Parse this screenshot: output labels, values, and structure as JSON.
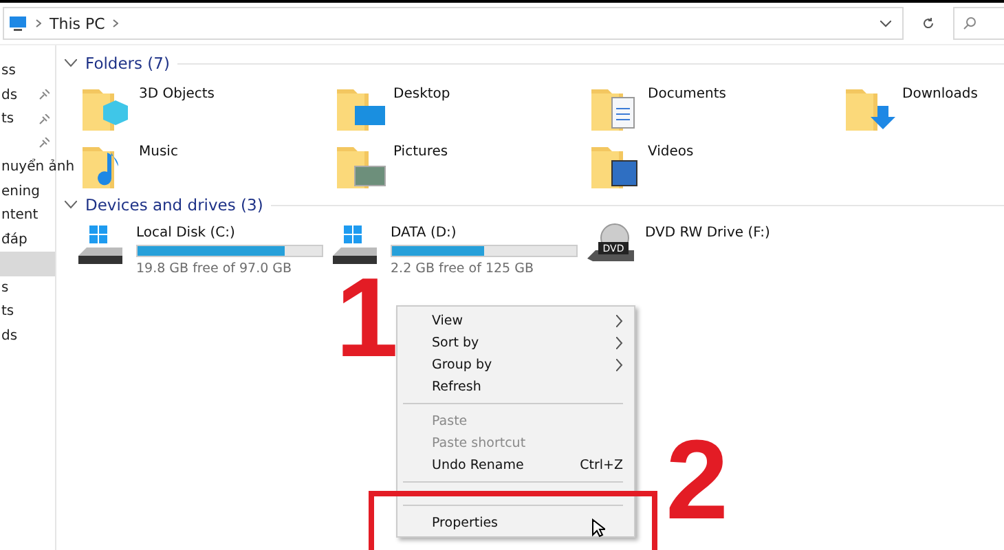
{
  "address_bar": {
    "path": [
      "This PC"
    ]
  },
  "sidebar": {
    "items": [
      {
        "label": "ss",
        "pinned": false,
        "selected": false
      },
      {
        "label": "ds",
        "pinned": true,
        "selected": false
      },
      {
        "label": "ts",
        "pinned": true,
        "selected": false
      },
      {
        "pinned": true,
        "selected": false
      },
      {
        "label": "nuyển ảnh",
        "pinned": false,
        "selected": false
      },
      {
        "label": "ening",
        "pinned": false,
        "selected": false
      },
      {
        "label": "ntent",
        "pinned": false,
        "selected": false
      },
      {
        "label": "đáp",
        "pinned": false,
        "selected": false
      },
      {
        "pinned": false,
        "selected": true
      },
      {
        "label": "s",
        "pinned": false,
        "selected": false
      },
      {
        "label": "ts",
        "pinned": false,
        "selected": false
      },
      {
        "label": "ds",
        "pinned": false,
        "selected": false
      }
    ]
  },
  "folders": {
    "title": "Folders (7)",
    "items": [
      {
        "name": "3D Objects",
        "kind": "cube"
      },
      {
        "name": "Desktop",
        "kind": "desktop"
      },
      {
        "name": "Documents",
        "kind": "documents"
      },
      {
        "name": "Downloads",
        "kind": "download"
      },
      {
        "name": "Music",
        "kind": "music"
      },
      {
        "name": "Pictures",
        "kind": "pictures"
      },
      {
        "name": "Videos",
        "kind": "videos"
      }
    ]
  },
  "drives": {
    "title": "Devices and drives (3)",
    "items": [
      {
        "name": "Local Disk (C:)",
        "kind": "disk",
        "level": 0.8,
        "free": "19.8 GB free of 97.0 GB"
      },
      {
        "name": "DATA (D:)",
        "kind": "disk",
        "level": 0.5,
        "free": "2.2 GB free of 125 GB"
      },
      {
        "name": "DVD RW Drive (F:)",
        "kind": "dvd",
        "dvd_label": "DVD"
      }
    ]
  },
  "context_menu": {
    "items": [
      {
        "kind": "item",
        "label": "View",
        "submenu": true,
        "disabled": false
      },
      {
        "kind": "item",
        "label": "Sort by",
        "submenu": true,
        "disabled": false
      },
      {
        "kind": "item",
        "label": "Group by",
        "submenu": true,
        "disabled": false
      },
      {
        "kind": "item",
        "label": "Refresh",
        "submenu": false,
        "disabled": false
      },
      {
        "kind": "separator"
      },
      {
        "kind": "item",
        "label": "Paste",
        "submenu": false,
        "disabled": true
      },
      {
        "kind": "item",
        "label": "Paste shortcut",
        "submenu": false,
        "disabled": true
      },
      {
        "kind": "item",
        "label": "Undo Rename",
        "shortcut": "Ctrl+Z",
        "submenu": false,
        "disabled": false
      },
      {
        "kind": "separator"
      },
      {
        "kind": "hidden"
      },
      {
        "kind": "separator"
      },
      {
        "kind": "item",
        "label": "Properties",
        "submenu": false,
        "disabled": false
      }
    ]
  },
  "annotations": [
    {
      "label": "1"
    },
    {
      "label": "2"
    }
  ]
}
